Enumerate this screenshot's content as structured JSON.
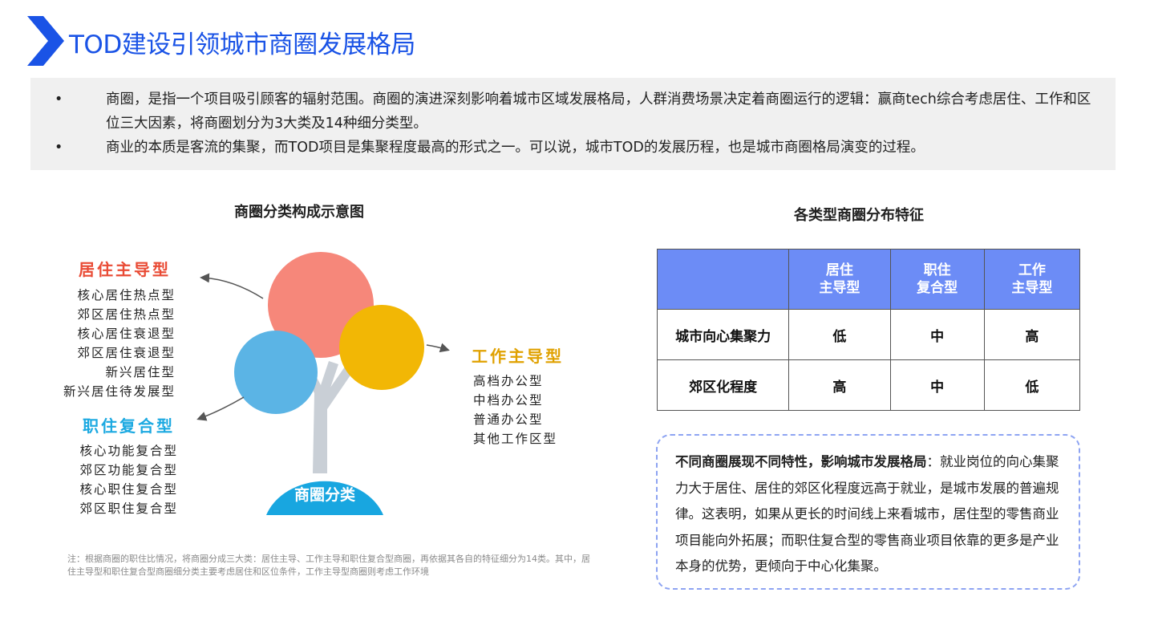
{
  "header": {
    "title": "TOD建设引领城市商圈发展格局"
  },
  "intro": {
    "bullets": [
      "商圈，是指一个项目吸引顾客的辐射范围。商圈的演进深刻影响着城市区域发展格局，人群消费场景决定着商圈运行的逻辑：赢商tech综合考虑居住、工作和区位三大因素，将商圈划分为3大类及14种细分类型。",
      "商业的本质是客流的集聚，而TOD项目是集聚程度最高的形式之一。可以说，城市TOD的发展历程，也是城市商圈格局演变的过程。"
    ]
  },
  "diagram": {
    "title": "商圈分类构成示意图",
    "base_label": "商圈分类",
    "categories": {
      "residential": {
        "title": "居住主导型",
        "items": [
          "核心居住热点型",
          "郊区居住热点型",
          "核心居住衰退型",
          "郊区居住衰退型",
          "新兴居住型",
          "新兴居住待发展型"
        ]
      },
      "mixed": {
        "title": "职住复合型",
        "items": [
          "核心功能复合型",
          "郊区功能复合型",
          "核心职住复合型",
          "郊区职住复合型"
        ]
      },
      "work": {
        "title": "工作主导型",
        "items": [
          "高档办公型",
          "中档办公型",
          "普通办公型",
          "其他工作区型"
        ]
      }
    },
    "colors": {
      "residential": "#f6877a",
      "mixed": "#5bb4e5",
      "work": "#f2b705",
      "trunk": "#c9cfd6",
      "base": "#18a6e0"
    },
    "note": "注：根据商圈的职住比情况，将商圈分成三大类：居住主导、工作主导和职住复合型商圈，再依据其各自的特征细分为14类。其中，居住主导型和职住复合型商圈细分类主要考虑居住和区位条件，工作主导型商圈则考虑工作环境"
  },
  "table": {
    "title": "各类型商圈分布特征",
    "headers": [
      "",
      [
        "居住",
        "主导型"
      ],
      [
        "职住",
        "复合型"
      ],
      [
        "工作",
        "主导型"
      ]
    ],
    "rows": [
      [
        "城市向心集聚力",
        "低",
        "中",
        "高"
      ],
      [
        "郊区化程度",
        "高",
        "中",
        "低"
      ]
    ],
    "header_color": "#6c8cf6"
  },
  "callout": {
    "lead": "不同商圈展现不同特性，影响城市发展格局",
    "body": "：就业岗位的向心集聚力大于居住、居住的郊区化程度远高于就业，是城市发展的普遍规律。这表明，如果从更长的时间线上来看城市，居住型的零售商业项目能向外拓展；而职住复合型的零售商业项目依靠的更多是产业本身的优势，更倾向于中心化集聚。"
  }
}
